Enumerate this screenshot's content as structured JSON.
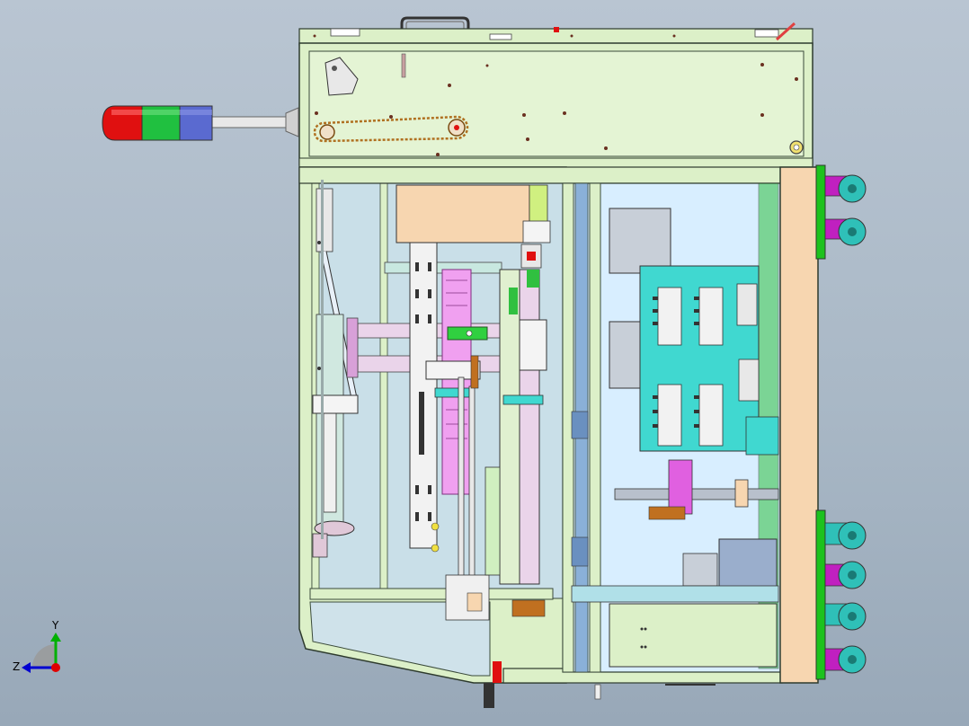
{
  "viewport": {
    "background_top": "#b9c5d2",
    "background_bottom": "#98a8b8"
  },
  "triad": {
    "y_label": "Y",
    "z_label": "Z",
    "x_color": "#e00000",
    "y_color": "#00b000",
    "z_color": "#0000d0"
  },
  "colors": {
    "frame": "#dcf0c8",
    "frame_edge": "#2d3a2d",
    "panel_light": "#c9dfe8",
    "cabinet": "#d8eeff",
    "tan": "#f7d6b0",
    "magenta": "#e060e0",
    "cyan": "#40d8d0",
    "green": "#30c040",
    "grey_blue": "#9aaecc",
    "wheel_green": "#1dc21d",
    "wheel_teal": "#2fc0b8",
    "wheel_magenta": "#c020c0",
    "light_red": "#e01010",
    "light_green": "#20c040",
    "light_blue": "#5a6ad0"
  },
  "icons": {
    "signal_tower": "three-tier-signal-light-icon",
    "caster": "caster-wheel-icon",
    "triad": "coordinate-axis-icon"
  }
}
